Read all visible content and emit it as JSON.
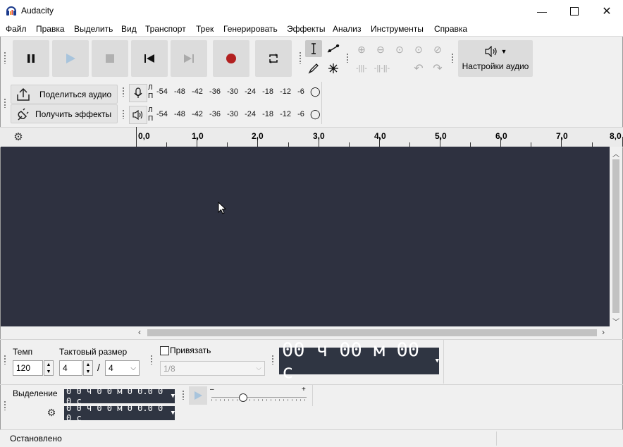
{
  "window": {
    "title": "Audacity"
  },
  "menu": [
    "Файл",
    "Правка",
    "Выделить",
    "Вид",
    "Транспорт",
    "Трек",
    "Генерировать",
    "Эффекты",
    "Анализ",
    "Инструменты",
    "Справка"
  ],
  "audio_setup": {
    "label": "Настройки аудио"
  },
  "share": {
    "share_label": "Поделиться аудио",
    "effects_label": "Получить эффекты"
  },
  "meters": {
    "record_channels": [
      "Л",
      "П"
    ],
    "play_channels": [
      "Л",
      "П"
    ],
    "scale": [
      "-54",
      "-48",
      "-42",
      "-36",
      "-30",
      "-24",
      "-18",
      "-12",
      "-6"
    ]
  },
  "timeline": {
    "ticks": [
      "0,0",
      "1,0",
      "2,0",
      "3,0",
      "4,0",
      "5,0",
      "6,0",
      "7,0",
      "8,0"
    ]
  },
  "tempo": {
    "label": "Темп",
    "value": "120"
  },
  "time_signature": {
    "label": "Тактовый размер",
    "numerator": "4",
    "separator": "/",
    "denominator": "4"
  },
  "snap": {
    "label": "Привязать",
    "value": "1/8",
    "checked": false
  },
  "time_display": {
    "text": "00 ч 00 м 00 с"
  },
  "selection": {
    "label": "Выделение",
    "start": "0 0 ч 0 0 м 0 0.0 0 0 с",
    "end": "0 0 ч 0 0 м 0 0.0 0 0 с"
  },
  "play_speed": {
    "min_label": "–",
    "max_label": "+"
  },
  "status": {
    "text": "Остановлено"
  }
}
